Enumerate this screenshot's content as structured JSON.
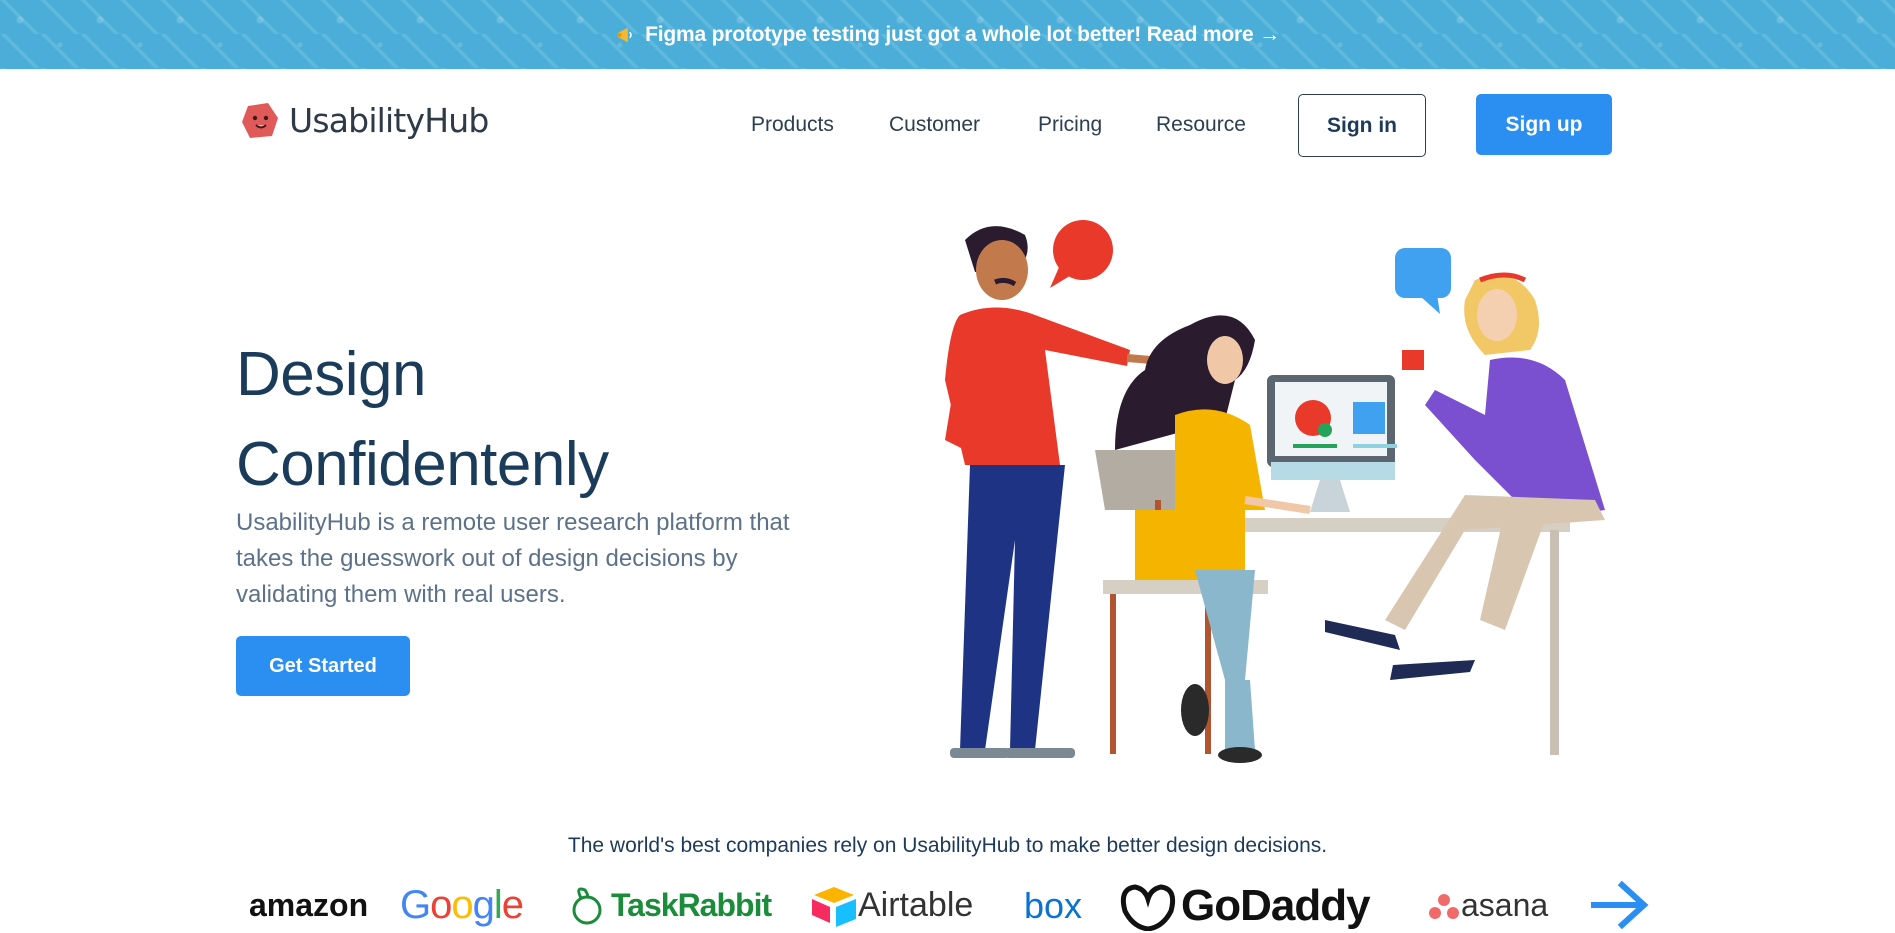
{
  "banner": {
    "icon": "megaphone-icon",
    "text": "Figma prototype testing just got a whole lot better! Read more →",
    "bg_color": "#4aaed8"
  },
  "header": {
    "logo_text": "UsabilityHub",
    "nav": [
      "Products",
      "Customer",
      "Pricing",
      "Resource"
    ],
    "sign_in": "Sign in",
    "sign_up": "Sign up",
    "accent_color": "#2a8ff0"
  },
  "hero": {
    "title_line1": "Design",
    "title_line2": "Confidentenly",
    "description": "UsabilityHub is a remote user research platform that takes the guesswork out of design decisions by validating them with real users.",
    "cta": "Get Started"
  },
  "companies": {
    "tagline": "The world's best companies rely on UsabilityHub to make better design decisions.",
    "logos": [
      "amazon",
      "Google",
      "TaskRabbit",
      "Airtable",
      "box",
      "GoDaddy",
      "asana"
    ],
    "next_icon": "arrow-right-icon"
  }
}
